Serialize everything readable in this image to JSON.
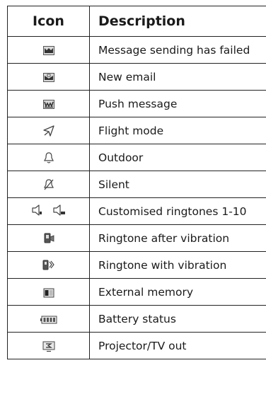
{
  "table": {
    "headers": {
      "icon": "Icon",
      "description": "Description"
    },
    "rows": [
      {
        "icon": "message-failed-icon",
        "description": "Message sending has failed"
      },
      {
        "icon": "new-email-icon",
        "description": "New email"
      },
      {
        "icon": "push-message-icon",
        "description": "Push message"
      },
      {
        "icon": "flight-mode-icon",
        "description": "Flight mode"
      },
      {
        "icon": "outdoor-bell-icon",
        "description": "Outdoor"
      },
      {
        "icon": "silent-icon",
        "description": "Silent"
      },
      {
        "icon": [
          "customised-ringtone-icon",
          "customised-ringtone-10-icon"
        ],
        "description": "Customised ringtones 1-10"
      },
      {
        "icon": "ringtone-after-vibration-icon",
        "description": "Ringtone after vibration"
      },
      {
        "icon": "ringtone-with-vibration-icon",
        "description": "Ringtone with vibration"
      },
      {
        "icon": "external-memory-icon",
        "description": "External memory"
      },
      {
        "icon": "battery-status-icon",
        "description": "Battery status"
      },
      {
        "icon": "projector-tv-out-icon",
        "description": "Projector/TV out"
      }
    ]
  }
}
